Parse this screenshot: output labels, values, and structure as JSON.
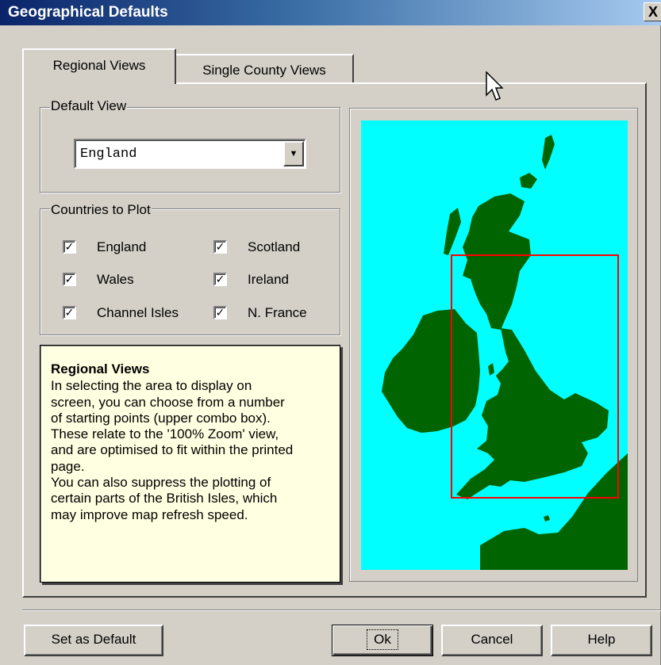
{
  "window": {
    "title": "Geographical Defaults",
    "close_label": "X"
  },
  "tabs": [
    {
      "label": "Regional Views",
      "active": true
    },
    {
      "label": "Single County Views",
      "active": false
    }
  ],
  "default_view": {
    "group_label": "Default View",
    "selected": "England"
  },
  "countries": {
    "group_label": "Countries to Plot",
    "items": [
      {
        "label": "England",
        "checked": true,
        "check": "✓"
      },
      {
        "label": "Scotland",
        "checked": true,
        "check": "✓"
      },
      {
        "label": "Wales",
        "checked": true,
        "check": "✓"
      },
      {
        "label": "Ireland",
        "checked": true,
        "check": "✓"
      },
      {
        "label": "Channel Isles",
        "checked": true,
        "check": "✓"
      },
      {
        "label": "N. France",
        "checked": true,
        "check": "✓"
      }
    ]
  },
  "help": {
    "heading": "Regional Views",
    "lines": [
      "In selecting the area to display on",
      "screen, you can choose from a number",
      "of starting points (upper combo box).",
      "These relate to the '100% Zoom' view,",
      "and are optimised to fit within the printed",
      "page.",
      "You can also suppress the plotting of",
      "certain parts of the British Isles, which",
      "may improve map refresh speed."
    ]
  },
  "map": {
    "sea_color": "#00ffff",
    "land_color": "#006400",
    "view_rect_color": "#ff0000"
  },
  "buttons": {
    "set_default": "Set as Default",
    "ok": "Ok",
    "cancel": "Cancel",
    "help": "Help"
  }
}
